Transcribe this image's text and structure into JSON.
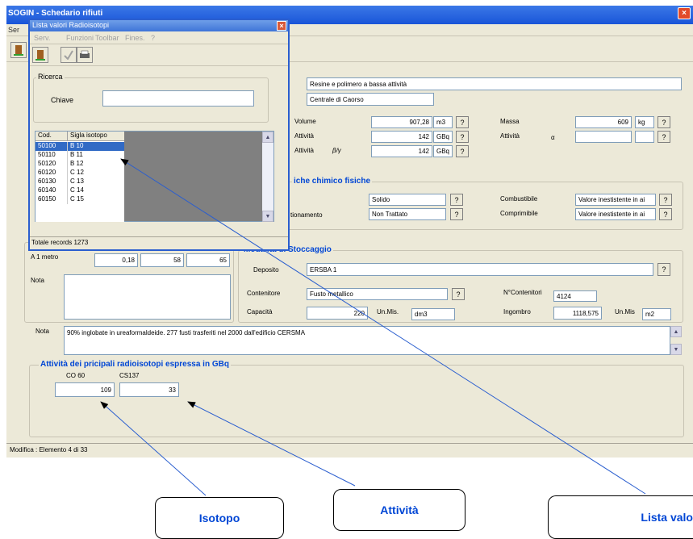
{
  "main_window": {
    "title": "SOGIN - Schedario rifiuti",
    "menu_partial": "Ser",
    "status_text": "Modifica : Elemento 4 di 33",
    "close_glyph": "×"
  },
  "popup": {
    "title": "Lista valori Radioisotopi",
    "close_glyph": "×",
    "menu": [
      "Serv.",
      "Funzioni",
      "Toolbar",
      "Fines.",
      "?"
    ],
    "search_group": "Ricerca",
    "search_label": "Chiave",
    "search_value": "",
    "list_headers": [
      "Cod.",
      "Sigla isotopo"
    ],
    "list_rows": [
      {
        "code": "50100",
        "sigla": "B 10",
        "selected": true
      },
      {
        "code": "50110",
        "sigla": "B 11",
        "selected": false
      },
      {
        "code": "50120",
        "sigla": "B 12",
        "selected": false
      },
      {
        "code": "60120",
        "sigla": "C 12",
        "selected": false
      },
      {
        "code": "60130",
        "sigla": "C 13",
        "selected": false
      },
      {
        "code": "60140",
        "sigla": "C 14",
        "selected": false
      },
      {
        "code": "60150",
        "sigla": "C 15",
        "selected": false
      }
    ],
    "total_records": "Totale records 1273"
  },
  "form": {
    "descrizione": "Resine e polimero a bassa attività",
    "centrale": "Centrale di Caorso",
    "volume_label": "Volume",
    "volume_value": "907,28",
    "volume_unit": "m3",
    "attivita_label": "Attività",
    "attivita_value": "142",
    "attivita_unit": "GBq",
    "attivita_by_label": "Attività",
    "attivita_by_symbol": "β/γ",
    "attivita_by_value": "142",
    "attivita_by_unit": "GBq",
    "massa_label": "Massa",
    "massa_value": "609",
    "massa_unit": "kg",
    "attivita_alpha_label": "Attività",
    "alpha_symbol": "α",
    "attivita_alpha_value": "",
    "attivita_alpha_unit": "",
    "q": "?"
  },
  "chem_group": {
    "title": "iche chimico fisiche",
    "stato_value": "Solido",
    "trattamento_label": "tionamento",
    "trattamento_value": "Non Trattato",
    "combustibile_label": "Combustibile",
    "combustibile_value": "Valore inestistente in ai",
    "comprimibile_label": "Comprimibile",
    "comprimibile_value": "Valore inestistente in ai"
  },
  "dose_group": {
    "label": "A 1 metro",
    "values": [
      "0,18",
      "58",
      "65"
    ],
    "nota_label": "Nota"
  },
  "stoccaggio": {
    "title": "Modalità di Stoccaggio",
    "deposito_label": "Deposito",
    "deposito_value": "ERSBA 1",
    "contenitore_label": "Contenitore",
    "contenitore_value": "Fusto metallico",
    "ncontenitori_label": "N°Contenitori",
    "ncontenitori_value": "4124",
    "capacita_label": "Capacità",
    "capacita_value": "220",
    "unmis_label": "Un.Mis.",
    "unmis_value": "dm3",
    "ingombro_label": "Ingombro",
    "ingombro_value": "1118,575",
    "unmis2_label": "Un.Mis",
    "unmis2_value": "m2"
  },
  "nota_main": {
    "label": "Nota",
    "text": "90% inglobate in ureaformaldeide. 277 fusti trasferiti nel 2000 dall'edificio CERSMA"
  },
  "isotopes": {
    "title": "Attività dei pricipali radioisotopi espressa in  GBq",
    "items": [
      {
        "name": "CO 60",
        "value": "109"
      },
      {
        "name": "CS137",
        "value": "33"
      }
    ]
  },
  "callouts": {
    "isotopo": "Isotopo",
    "attivita": "Attività",
    "lista": "Lista valo"
  }
}
